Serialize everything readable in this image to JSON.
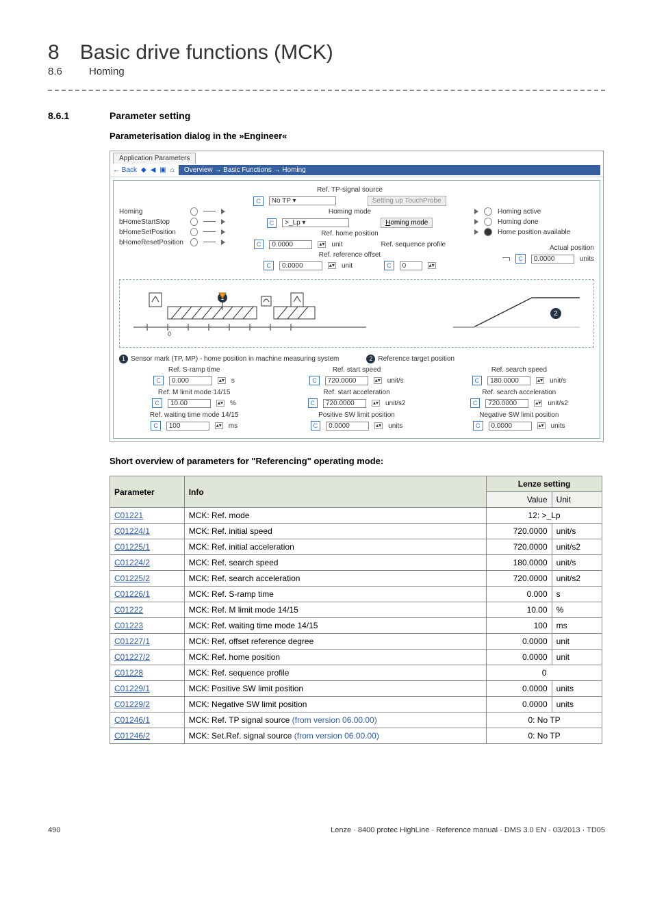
{
  "header": {
    "num": "8",
    "title": "Basic drive functions (MCK)",
    "subnum": "8.6",
    "subtitle": "Homing"
  },
  "section": {
    "num": "8.6.1",
    "title": "Parameter setting"
  },
  "caption1": "Parameterisation dialog in the »Engineer«",
  "appTab": "Application Parameters",
  "toolbar": {
    "back": "Back",
    "glyphs": [
      "◆",
      "◀",
      "▣",
      "⌂"
    ]
  },
  "breadcrumb": "Overview → Basic Functions → Homing",
  "leftIO": {
    "homing": "Homing",
    "startStop": "bHomeStartStop",
    "setPos": "bHomeSetPosition",
    "resetPos": "bHomeResetPosition"
  },
  "mid": {
    "tpSrcLbl": "Ref. TP-signal source",
    "tpSrc": "No TP",
    "modeLbl": "Homing mode",
    "mode": ">_Lp",
    "homePosLbl": "Ref. home position",
    "homePos": "0.0000",
    "unit": "unit",
    "refOffLbl": "Ref. reference offset",
    "refOff": "0.0000",
    "btnSetup": "Setting up TouchProbe",
    "btnMode": "Homing mode",
    "seqLbl": "Ref. sequence profile",
    "seq": "0"
  },
  "rightIO": {
    "active": "Homing active",
    "done": "Homing done",
    "avail": "Home position available",
    "actLbl": "Actual position",
    "actVal": "0.0000",
    "actUnit": "units"
  },
  "diag": {
    "legend1": "Sensor mark (TP, MP) - home position in machine measuring system",
    "legend2": "Reference target position"
  },
  "paramsGrid": {
    "r1": {
      "a": {
        "l": "Ref. S-ramp time",
        "v": "0.000",
        "u": "s"
      },
      "b": {
        "l": "Ref. start speed",
        "v": "720.0000",
        "u": "unit/s"
      },
      "c": {
        "l": "Ref. search speed",
        "v": "180.0000",
        "u": "unit/s"
      }
    },
    "r2": {
      "a": {
        "l": "Ref. M limit mode 14/15",
        "v": "10.00",
        "u": "%"
      },
      "b": {
        "l": "Ref. start acceleration",
        "v": "720.0000",
        "u": "unit/s2"
      },
      "c": {
        "l": "Ref. search acceleration",
        "v": "720.0000",
        "u": "unit/s2"
      }
    },
    "r3": {
      "a": {
        "l": "Ref. waiting time mode 14/15",
        "v": "100",
        "u": "ms"
      },
      "b": {
        "l": "Positive SW limit position",
        "v": "0.0000",
        "u": "units"
      },
      "c": {
        "l": "Negative SW limit position",
        "v": "0.0000",
        "u": "units"
      }
    }
  },
  "tableCaption": "Short overview of parameters for \"Referencing\" operating mode:",
  "th": {
    "param": "Parameter",
    "info": "Info",
    "lenze": "Lenze setting",
    "value": "Value",
    "unit": "Unit"
  },
  "rows": [
    {
      "p": "C01221",
      "i": "MCK: Ref. mode",
      "v": "12: >_Lp",
      "u": ""
    },
    {
      "p": "C01224/1",
      "i": "MCK: Ref. initial speed",
      "v": "720.0000",
      "u": "unit/s"
    },
    {
      "p": "C01225/1",
      "i": "MCK: Ref. initial acceleration",
      "v": "720.0000",
      "u": "unit/s2"
    },
    {
      "p": "C01224/2",
      "i": "MCK: Ref. search speed",
      "v": "180.0000",
      "u": "unit/s"
    },
    {
      "p": "C01225/2",
      "i": "MCK: Ref. search acceleration",
      "v": "720.0000",
      "u": "unit/s2"
    },
    {
      "p": "C01226/1",
      "i": "MCK: Ref. S-ramp time",
      "v": "0.000",
      "u": "s"
    },
    {
      "p": "C01222",
      "i": "MCK: Ref. M limit mode 14/15",
      "v": "10.00",
      "u": "%"
    },
    {
      "p": "C01223",
      "i": "MCK: Ref. waiting time mode 14/15",
      "v": "100",
      "u": "ms"
    },
    {
      "p": "C01227/1",
      "i": "MCK: Ref. offset reference degree",
      "v": "0.0000",
      "u": "unit"
    },
    {
      "p": "C01227/2",
      "i": "MCK: Ref. home position",
      "v": "0.0000",
      "u": "unit"
    },
    {
      "p": "C01228",
      "i": "MCK: Ref. sequence profile",
      "v": "0",
      "u": ""
    },
    {
      "p": "C01229/1",
      "i": "MCK: Positive SW limit position",
      "v": "0.0000",
      "u": "units"
    },
    {
      "p": "C01229/2",
      "i": "MCK: Negative SW limit position",
      "v": "0.0000",
      "u": "units"
    },
    {
      "p": "C01246/1",
      "i": "MCK: Ref. TP signal source ",
      "fver": "(from version 06.00.00)",
      "v": "0: No TP",
      "u": ""
    },
    {
      "p": "C01246/2",
      "i": "MCK: Set.Ref. signal source ",
      "fver": "(from version 06.00.00)",
      "v": "0: No TP",
      "u": ""
    }
  ],
  "footer": {
    "page": "490",
    "info": "Lenze · 8400 protec HighLine · Reference manual · DMS 3.0 EN · 03/2013 · TD05"
  }
}
